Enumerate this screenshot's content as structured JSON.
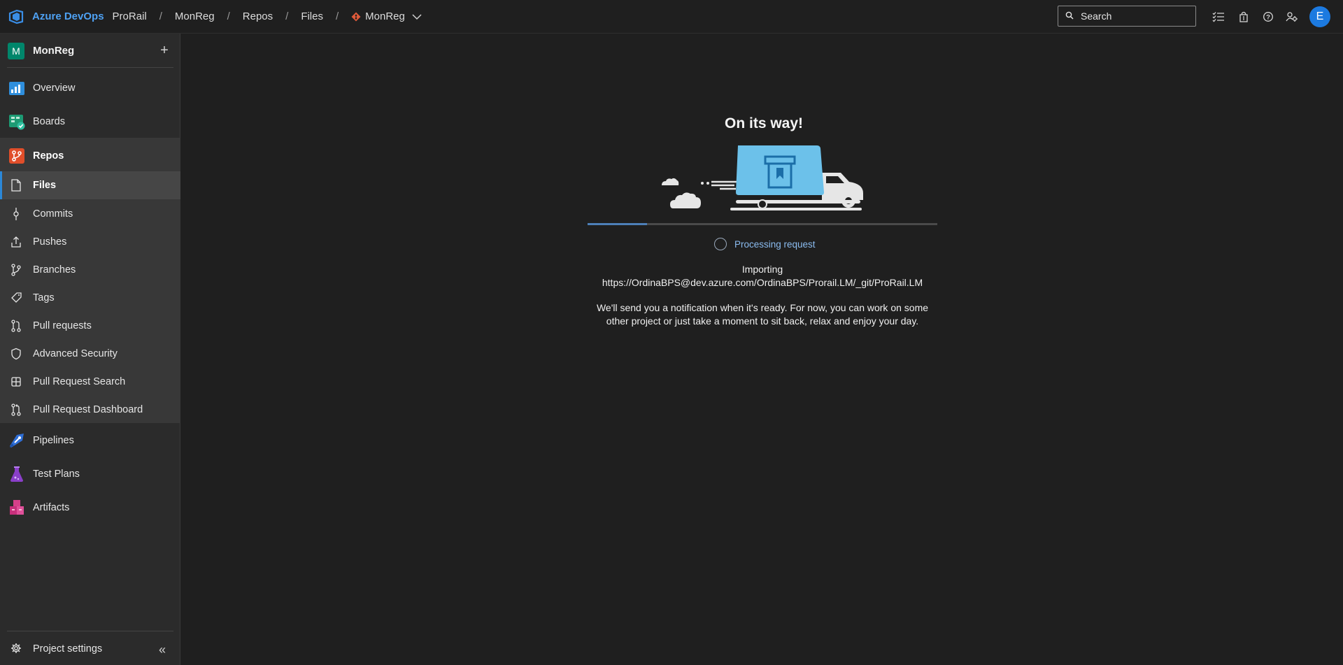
{
  "topbar": {
    "brand": "Azure DevOps",
    "breadcrumbs": [
      "ProRail",
      "MonReg",
      "Repos",
      "Files"
    ],
    "repo_selector": "MonReg",
    "separator": "/",
    "search_placeholder": "Search",
    "avatar_initial": "E",
    "icons": [
      "azure-devops-logo-icon",
      "task-list-icon",
      "marketplace-bag-icon",
      "help-icon",
      "user-settings-icon"
    ]
  },
  "sidebar": {
    "project_initial": "M",
    "project_name": "MonReg",
    "add_label": "+",
    "items": [
      {
        "label": "Overview",
        "icon": "overview-icon"
      },
      {
        "label": "Boards",
        "icon": "boards-icon"
      },
      {
        "label": "Repos",
        "icon": "repos-icon"
      },
      {
        "label": "Files",
        "icon": "file-icon"
      },
      {
        "label": "Commits",
        "icon": "commit-icon"
      },
      {
        "label": "Pushes",
        "icon": "push-icon"
      },
      {
        "label": "Branches",
        "icon": "branch-icon"
      },
      {
        "label": "Tags",
        "icon": "tag-icon"
      },
      {
        "label": "Pull requests",
        "icon": "pull-request-icon"
      },
      {
        "label": "Advanced Security",
        "icon": "shield-icon"
      },
      {
        "label": "Pull Request Search",
        "icon": "grid-icon"
      },
      {
        "label": "Pull Request Dashboard",
        "icon": "pull-request-dashboard-icon"
      },
      {
        "label": "Pipelines",
        "icon": "pipelines-icon"
      },
      {
        "label": "Test Plans",
        "icon": "test-plans-icon"
      },
      {
        "label": "Artifacts",
        "icon": "artifacts-icon"
      }
    ],
    "settings_label": "Project settings",
    "collapse_label": "«"
  },
  "main": {
    "title": "On its way!",
    "progress_fraction": 0.17,
    "status": "Processing request",
    "importing_label": "Importing",
    "import_url": "https://OrdinaBPS@dev.azure.com/OrdinaBPS/Prorail.LM/_git/ProRail.LM",
    "message_line1": "We'll send you a notification when it's ready. For now, you can work on some",
    "message_line2": "other project or just take a moment to sit back, relax and enjoy your day."
  },
  "colors": {
    "accent": "#2b88d8",
    "brand": "#4ea1f3",
    "avatar": "#1c7ae0",
    "project": "#00866b",
    "truck_box": "#6cc1ea"
  }
}
